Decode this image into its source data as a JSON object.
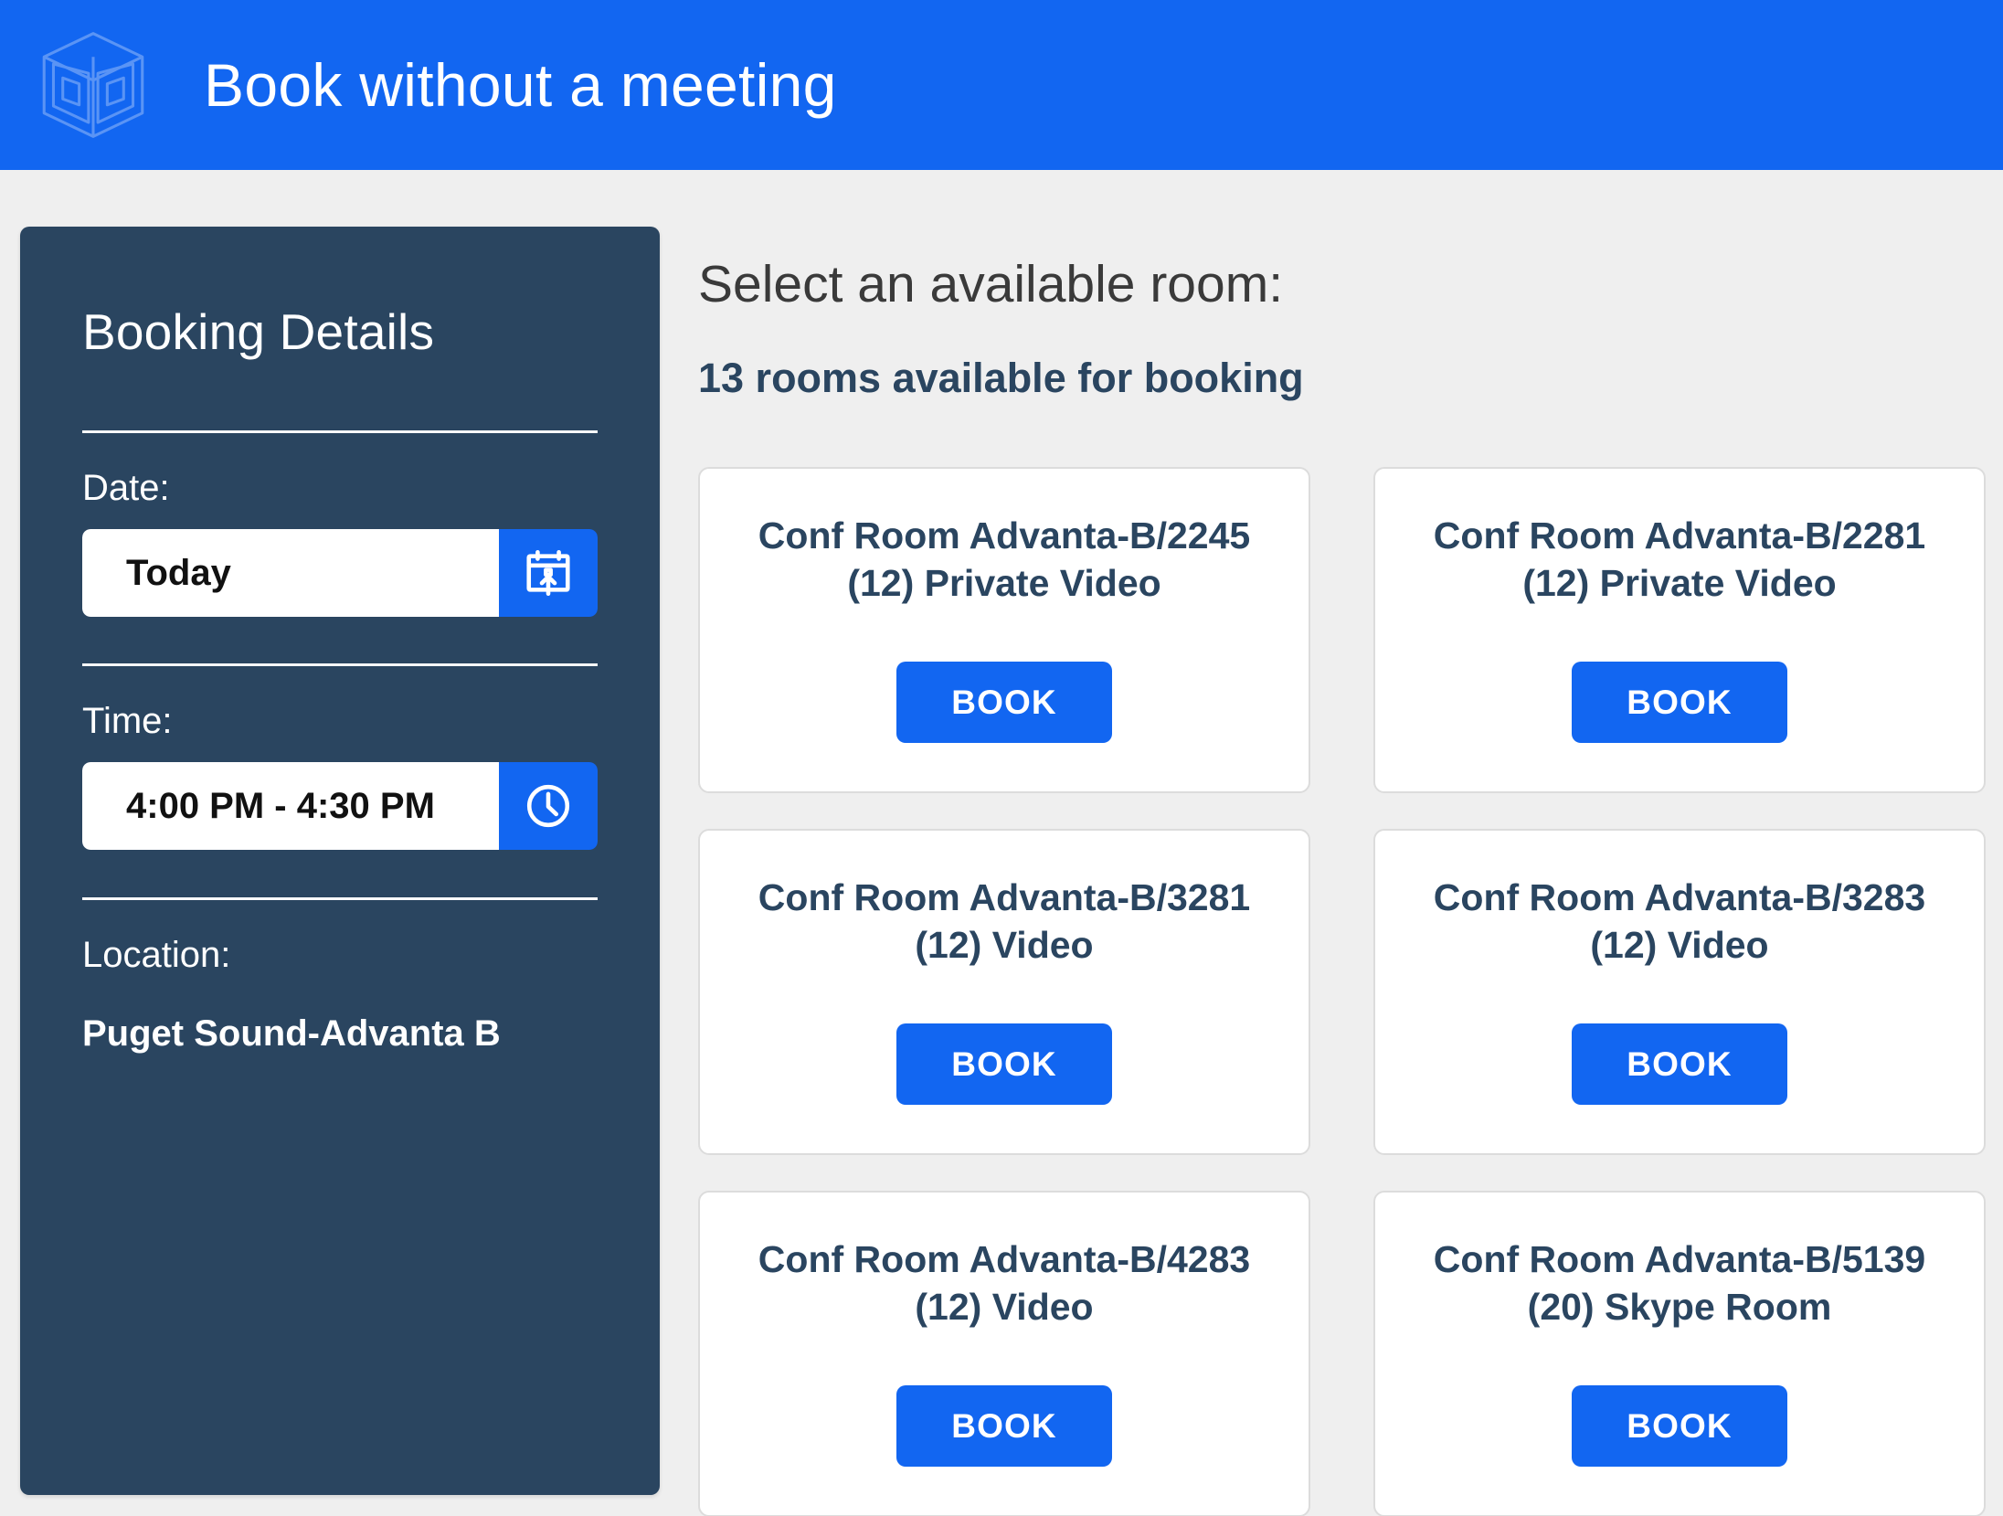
{
  "header": {
    "title": "Book without a meeting",
    "logo_icon": "room-cube-logo-icon",
    "background_color": "#1266f1"
  },
  "sidebar": {
    "title": "Booking Details",
    "background_color": "#2a4560",
    "date": {
      "label": "Date:",
      "value": "Today",
      "picker_icon": "calendar-upload-icon"
    },
    "time": {
      "label": "Time:",
      "value": "4:00 PM - 4:30 PM",
      "picker_icon": "clock-icon"
    },
    "location": {
      "label": "Location:",
      "value": "Puget Sound-Advanta B"
    }
  },
  "main": {
    "heading": "Select an available room:",
    "subheading": "13 rooms available for booking",
    "available_count": 13,
    "book_label": "BOOK",
    "accent_color": "#1266f1",
    "rooms": [
      {
        "name": "Conf Room Advanta-B/2245 (12) Private Video"
      },
      {
        "name": "Conf Room Advanta-B/2281 (12) Private Video"
      },
      {
        "name": "Conf Room Advanta-B/3281 (12) Video"
      },
      {
        "name": "Conf Room Advanta-B/3283 (12) Video"
      },
      {
        "name": "Conf Room Advanta-B/4283 (12) Video"
      },
      {
        "name": "Conf Room Advanta-B/5139 (20) Skype Room"
      }
    ]
  }
}
